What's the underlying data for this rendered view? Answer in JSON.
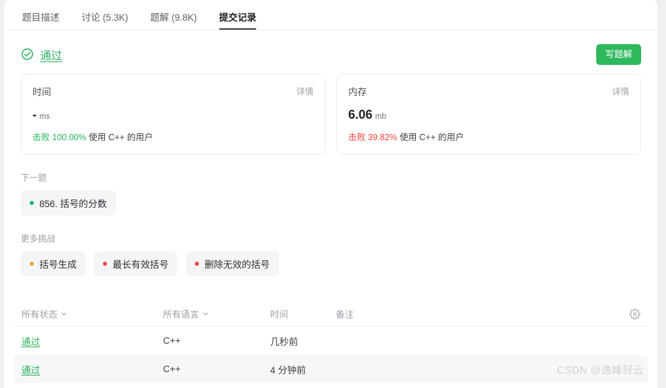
{
  "tabs": [
    {
      "label": "题目描述",
      "active": false
    },
    {
      "label": "讨论 (5.3K)",
      "active": false
    },
    {
      "label": "题解 (9.8K)",
      "active": false
    },
    {
      "label": "提交记录",
      "active": true
    }
  ],
  "status": {
    "icon": "check-circle-icon",
    "label": "通过",
    "color": "#2ab35b"
  },
  "write_solution_button": {
    "label": "写题解",
    "color": "#2eb85c"
  },
  "metrics": [
    {
      "title": "时间",
      "detail_label": "详情",
      "value": "-",
      "unit": "ms",
      "beat_prefix": "击败",
      "beat_percent": "100.00%",
      "beat_suffix": "使用 C++ 的用户",
      "beat_color": "#2ab35b"
    },
    {
      "title": "内存",
      "detail_label": "详情",
      "value": "6.06",
      "unit": "mb",
      "beat_prefix": "击败",
      "beat_percent": "39.82%",
      "beat_suffix": "使用 C++ 的用户",
      "beat_color": "#f4443c"
    }
  ],
  "next_problem": {
    "label": "下一题",
    "items": [
      {
        "text": "856. 括号的分数",
        "dot_color": "#19b57d"
      }
    ]
  },
  "more_challenges": {
    "label": "更多挑战",
    "items": [
      {
        "text": "括号生成",
        "dot_color": "#efa32b"
      },
      {
        "text": "最长有效括号",
        "dot_color": "#ef4b4b"
      },
      {
        "text": "删除无效的括号",
        "dot_color": "#ef4b4b"
      }
    ]
  },
  "submissions_table": {
    "headers": {
      "status": "所有状态",
      "language": "所有语言",
      "time": "时间",
      "note": "备注"
    },
    "settings_icon": "gear-icon",
    "rows": [
      {
        "status": "通过",
        "language": "C++",
        "time": "几秒前",
        "note": ""
      },
      {
        "status": "通过",
        "language": "C++",
        "time": "4 分钟前",
        "note": ""
      }
    ]
  },
  "watermark": {
    "text": "CSDN @逸峰轻云"
  }
}
